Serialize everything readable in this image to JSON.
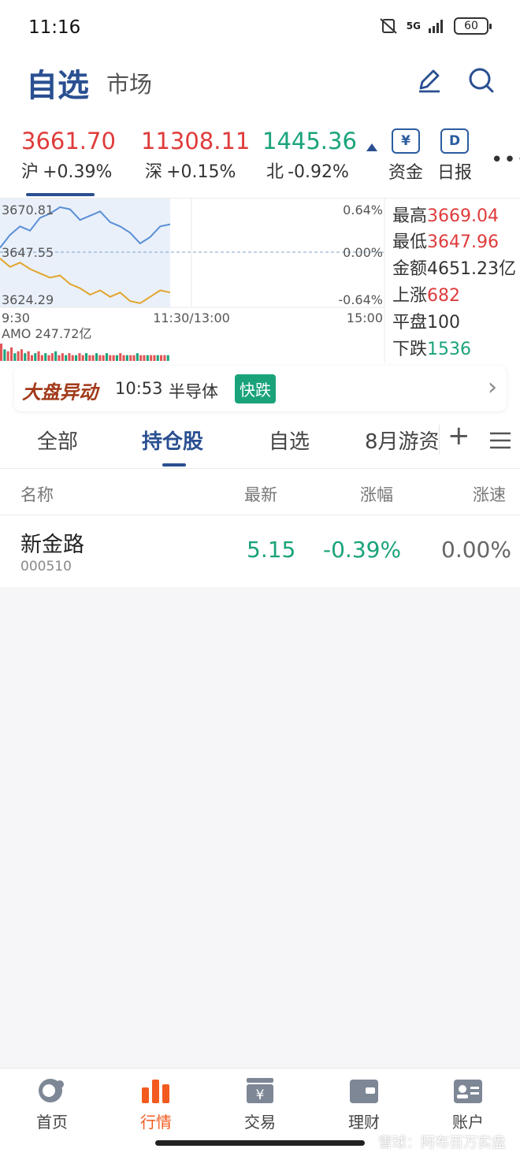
{
  "status_bar": {
    "time": "11:16",
    "network": "5G",
    "battery": "60"
  },
  "header": {
    "title": "自选",
    "market_tab": "市场",
    "edit_icon": "pencil-icon",
    "search_icon": "search-icon"
  },
  "indices": [
    {
      "value": "3661.70",
      "name": "沪",
      "change": "+0.39%",
      "direction": "up"
    },
    {
      "value": "11308.11",
      "name": "深",
      "change": "+0.15%",
      "direction": "up"
    },
    {
      "value": "1445.36",
      "name": "北",
      "change": "-0.92%",
      "direction": "down"
    }
  ],
  "top_actions": [
    {
      "label": "资金",
      "icon": "yuan-icon",
      "glyph": "¥"
    },
    {
      "label": "日报",
      "icon": "daily-report-icon",
      "glyph": "D"
    }
  ],
  "chart": {
    "y_high": "3670.81",
    "y_mid": "3647.55",
    "y_low": "3624.29",
    "pct_high": "0.64%",
    "pct_mid": "0.00%",
    "pct_low": "-0.64%",
    "x_start": "9:30",
    "x_mid": "11:30/13:00",
    "x_end": "15:00",
    "amo_label": "AMO 247.72亿"
  },
  "chart_data": {
    "type": "line",
    "y_range": [
      3624.29,
      3670.81
    ],
    "series": [
      {
        "color": "#5b8fd6",
        "values": [
          3650,
          3656,
          3660,
          3658,
          3664,
          3666,
          3669,
          3668,
          3663,
          3665,
          3667,
          3662,
          3660,
          3657,
          3652,
          3655,
          3660,
          3661
        ]
      },
      {
        "color": "#e3a52e",
        "values": [
          3645,
          3641,
          3643,
          3640,
          3638,
          3636,
          3637,
          3633,
          3631,
          3628,
          3630,
          3627,
          3629,
          3625,
          3624,
          3627,
          3630,
          3629
        ]
      }
    ],
    "volume": [
      9,
      6,
      5,
      7,
      4,
      5,
      6,
      4,
      5,
      3,
      4,
      5,
      3,
      4,
      3,
      4,
      5,
      3,
      4,
      3,
      4,
      3,
      3,
      4,
      3,
      4,
      3,
      3,
      4,
      3,
      3,
      4,
      3,
      3,
      3,
      4,
      3,
      3,
      3,
      3,
      4,
      3,
      3,
      3,
      3,
      3,
      3,
      3,
      3,
      3
    ]
  },
  "stats": [
    {
      "label": "最高",
      "value": "3669.04",
      "color": "red"
    },
    {
      "label": "最低",
      "value": "3647.96",
      "color": "red"
    },
    {
      "label": "金额",
      "value": "4651.23亿",
      "color": "neutral"
    },
    {
      "label": "上涨",
      "value": "682",
      "color": "red"
    },
    {
      "label": "平盘",
      "value": "100",
      "color": "neutral"
    },
    {
      "label": "下跌",
      "value": "1536",
      "color": "green"
    }
  ],
  "banner": {
    "title": "大盘异动",
    "time": "10:53",
    "topic": "半导体",
    "tag": "快跌"
  },
  "tabs": [
    {
      "label": "全部",
      "active": false
    },
    {
      "label": "持仓股",
      "active": true
    },
    {
      "label": "自选",
      "active": false
    },
    {
      "label": "8月游资",
      "active": false
    }
  ],
  "table": {
    "headers": [
      "名称",
      "最新",
      "涨幅",
      "涨速"
    ],
    "rows": [
      {
        "name": "新金路",
        "code": "000510",
        "price": "5.15",
        "change": "-0.39%",
        "speed": "0.00%"
      }
    ]
  },
  "nav": [
    {
      "label": "首页",
      "icon": "home-icon",
      "active": false
    },
    {
      "label": "行情",
      "icon": "market-bars-icon",
      "active": true
    },
    {
      "label": "交易",
      "icon": "trade-icon",
      "active": false
    },
    {
      "label": "理财",
      "icon": "wallet-icon",
      "active": false
    },
    {
      "label": "账户",
      "icon": "account-card-icon",
      "active": false
    }
  ],
  "watermark": "雪球：阿布百万实盘"
}
